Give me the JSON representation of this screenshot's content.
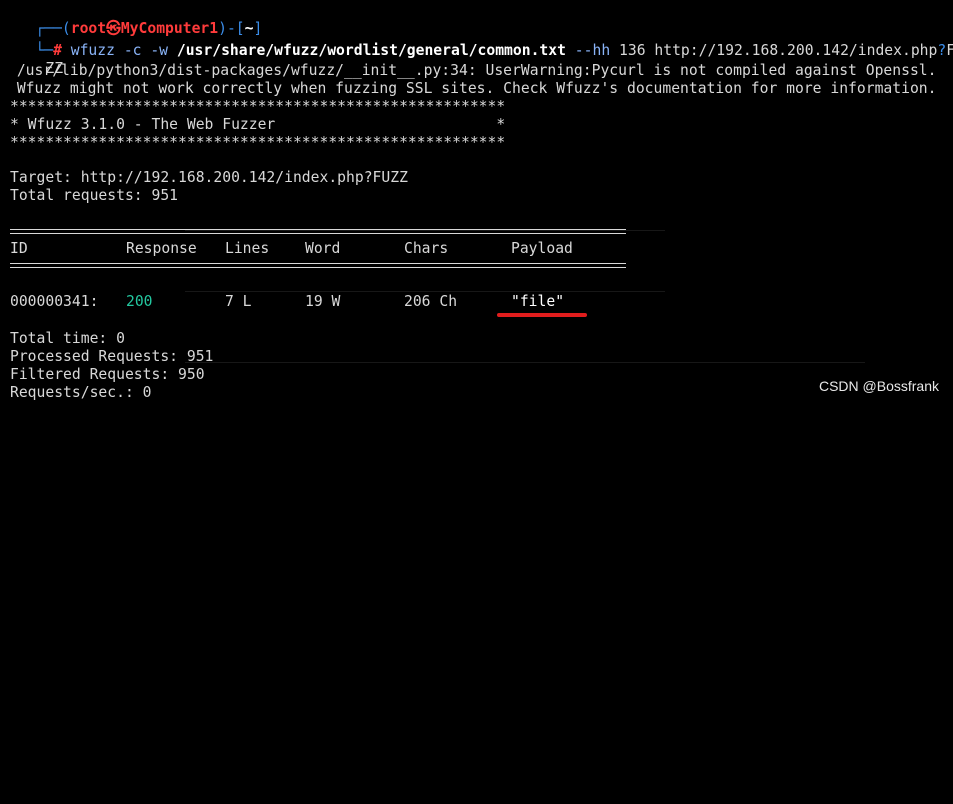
{
  "prompt": {
    "corner_top": "┌──",
    "open_paren": "(",
    "user": "root",
    "at_symbol": "㉿",
    "host": "MyComputer1",
    "close_paren": ")",
    "dash": "-",
    "open_bracket": "[",
    "cwd": "~",
    "close_bracket": "]",
    "corner_bottom": "└─",
    "hash": "#"
  },
  "command": {
    "program": "wfuzz",
    "flag_c": "-c",
    "flag_w": "-w",
    "wordlist": "/usr/share/wfuzz/wordlist/general/common.txt",
    "flag_hh": "--hh",
    "hh_value": "136",
    "url_start": "http://192.168.200.142/index.php",
    "url_q": "?",
    "url_end": "FU",
    "url_wrap": "ZZ"
  },
  "warnings": [
    " /usr/lib/python3/dist-packages/wfuzz/__init__.py:34: UserWarning:Pycurl is not compiled against Openssl.",
    " Wfuzz might not work correctly when fuzzing SSL sites. Check Wfuzz's documentation for more information."
  ],
  "banner": {
    "border_top": "********************************************************",
    "title": "* Wfuzz 3.1.0 - The Web Fuzzer                         *",
    "border_bottom": "********************************************************"
  },
  "target_line": "Target: http://192.168.200.142/index.php?FUZZ",
  "total_requests_line": "Total requests: 951",
  "table": {
    "headers": [
      "ID",
      "Response",
      "Lines",
      "Word",
      "Chars",
      "Payload"
    ],
    "rows": [
      {
        "id": "000000341:",
        "response": "200",
        "lines": "7 L",
        "word": "19 W",
        "chars": "206 Ch",
        "payload": "\"file\""
      }
    ]
  },
  "summary": [
    "Total time: 0",
    "Processed Requests: 951",
    "Filtered Requests: 950",
    "Requests/sec.: 0"
  ],
  "watermark": "CSDN @Bossfrank",
  "colors": {
    "background": "#000000",
    "prompt_frame": "#3b8eea",
    "prompt_user": "#ff3b3b",
    "response_200": "#23c8a0",
    "annotation_underline": "#e11d1d"
  }
}
